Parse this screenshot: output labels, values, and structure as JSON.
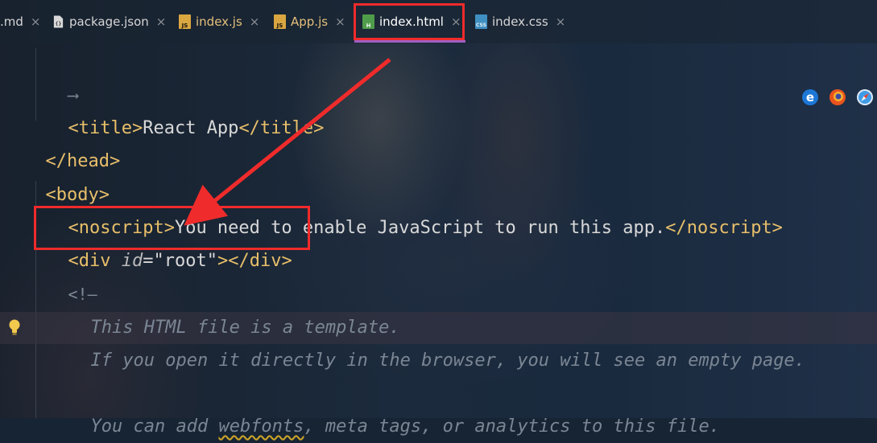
{
  "tabs": [
    {
      "label": ".md",
      "close": "×",
      "icon": "markdown-file-icon"
    },
    {
      "label": "package.json",
      "close": "×",
      "icon": "json-file-icon"
    },
    {
      "label": "index.js",
      "close": "×",
      "icon": "js-file-icon",
      "badge": "JS"
    },
    {
      "label": "App.js",
      "close": "×",
      "icon": "js-file-icon",
      "badge": "JS"
    },
    {
      "label": "index.html",
      "close": "×",
      "icon": "html-file-icon",
      "badge": "H",
      "active": true
    },
    {
      "label": "index.css",
      "close": "×",
      "icon": "css-file-icon",
      "badge": "CSS"
    }
  ],
  "code": {
    "line1_glyph": "⟶",
    "line2": {
      "open": "<title>",
      "text": "React App",
      "close": "</title>"
    },
    "line3": {
      "close": "</head>"
    },
    "line4": {
      "open": "<body>"
    },
    "line5": {
      "open": "<noscript>",
      "text": "You need to enable JavaScript to run this app.",
      "close": "</noscript>"
    },
    "line6": {
      "open_start": "<div ",
      "attr": "id",
      "eq": "=",
      "value": "\"root\"",
      "open_end": ">",
      "close": "</div>"
    },
    "line7_glyph": "<!—",
    "line8": "This HTML file is a template.",
    "line9": "If you open it directly in the browser, you will see an empty page.",
    "line11": {
      "before": "You can add ",
      "squiggle": "webfonts",
      "after": ", meta tags, or analytics to this file."
    }
  },
  "browser_icons": [
    "edge-icon",
    "firefox-icon",
    "safari-icon"
  ],
  "colors": {
    "tag": "#e8bf6a",
    "comment": "#7b8694",
    "annotation": "#f02b2b"
  }
}
